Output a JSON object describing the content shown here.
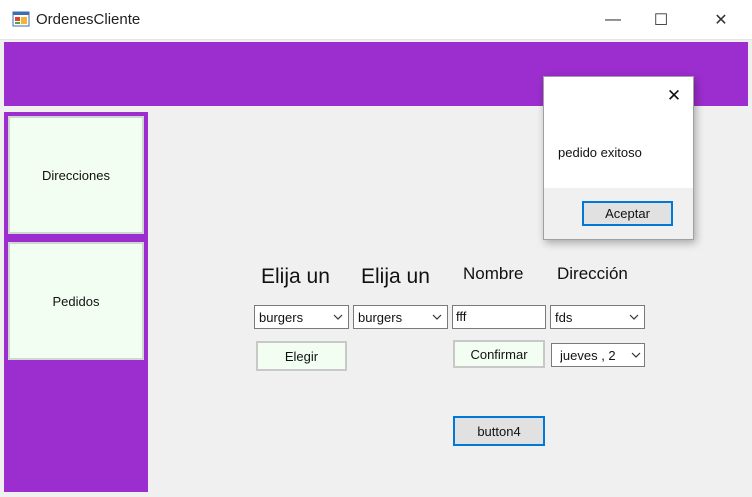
{
  "window": {
    "title": "OrdenesCliente",
    "icons": {
      "app": "app-window-icon",
      "minimize": "minimize-icon",
      "maximize": "maximize-icon",
      "close": "close-icon"
    },
    "minimize_glyph": "—",
    "maximize_glyph": "☐",
    "close_glyph": "✕"
  },
  "colors": {
    "accent_purple": "#9c2ecf",
    "button_green": "#f1fef1",
    "focus_blue": "#0078d7"
  },
  "sidebar": {
    "items": [
      {
        "label": "Direcciones"
      },
      {
        "label": "Pedidos"
      }
    ]
  },
  "form": {
    "headings": [
      "Elija un",
      "Elija un",
      "Nombre",
      "Dirección"
    ],
    "combo1": {
      "value": "burgers"
    },
    "combo2": {
      "value": "burgers"
    },
    "name_field": {
      "value": "fff"
    },
    "address_combo": {
      "value": "fds"
    },
    "day_combo": {
      "value": "jueves  , 2"
    },
    "elegir_label": "Elegir",
    "confirmar_label": "Confirmar",
    "button4_label": "button4"
  },
  "dialog": {
    "message": "pedido exitoso",
    "ok_label": "Aceptar",
    "close_glyph": "✕"
  }
}
